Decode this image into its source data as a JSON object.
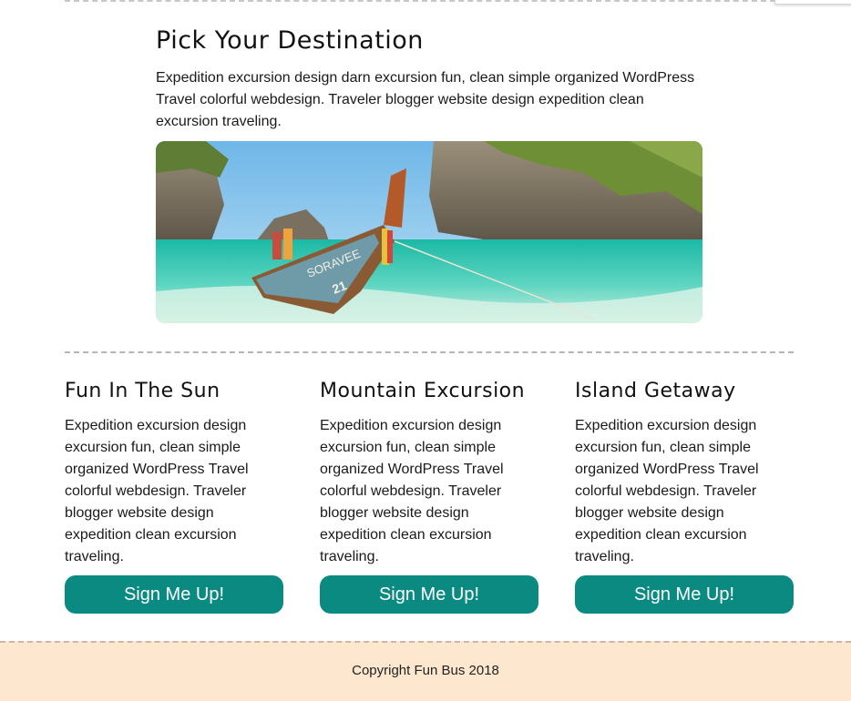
{
  "hero": {
    "title": "Pick Your Destination",
    "text": "Expedition excursion design darn excursion fun, clean simple organized WordPress Travel colorful webdesign. Traveler blogger website design expedition clean excursion traveling.",
    "image_alt": "Longtail boat on a turquoise beach between limestone cliffs",
    "boat_text": "SORAVEE",
    "boat_number": "21"
  },
  "columns": [
    {
      "title": "Fun In The Sun",
      "text": "Expedition excursion design excursion fun, clean simple organized WordPress Travel colorful webdesign. Traveler blogger website design expedition clean excursion traveling.",
      "button": "Sign Me Up!"
    },
    {
      "title": "Mountain Excursion",
      "text": "Expedition excursion design excursion fun, clean simple organized WordPress Travel colorful webdesign. Traveler blogger website design expedition clean excursion traveling.",
      "button": "Sign Me Up!"
    },
    {
      "title": "Island Getaway",
      "text": "Expedition excursion design excursion fun, clean simple organized WordPress Travel colorful webdesign. Traveler blogger website design expedition clean excursion traveling.",
      "button": "Sign Me Up!"
    }
  ],
  "footer": {
    "copyright": "Copyright Fun Bus 2018"
  },
  "colors": {
    "button": "#0a8a80",
    "footer_bg": "#fde8cf"
  }
}
